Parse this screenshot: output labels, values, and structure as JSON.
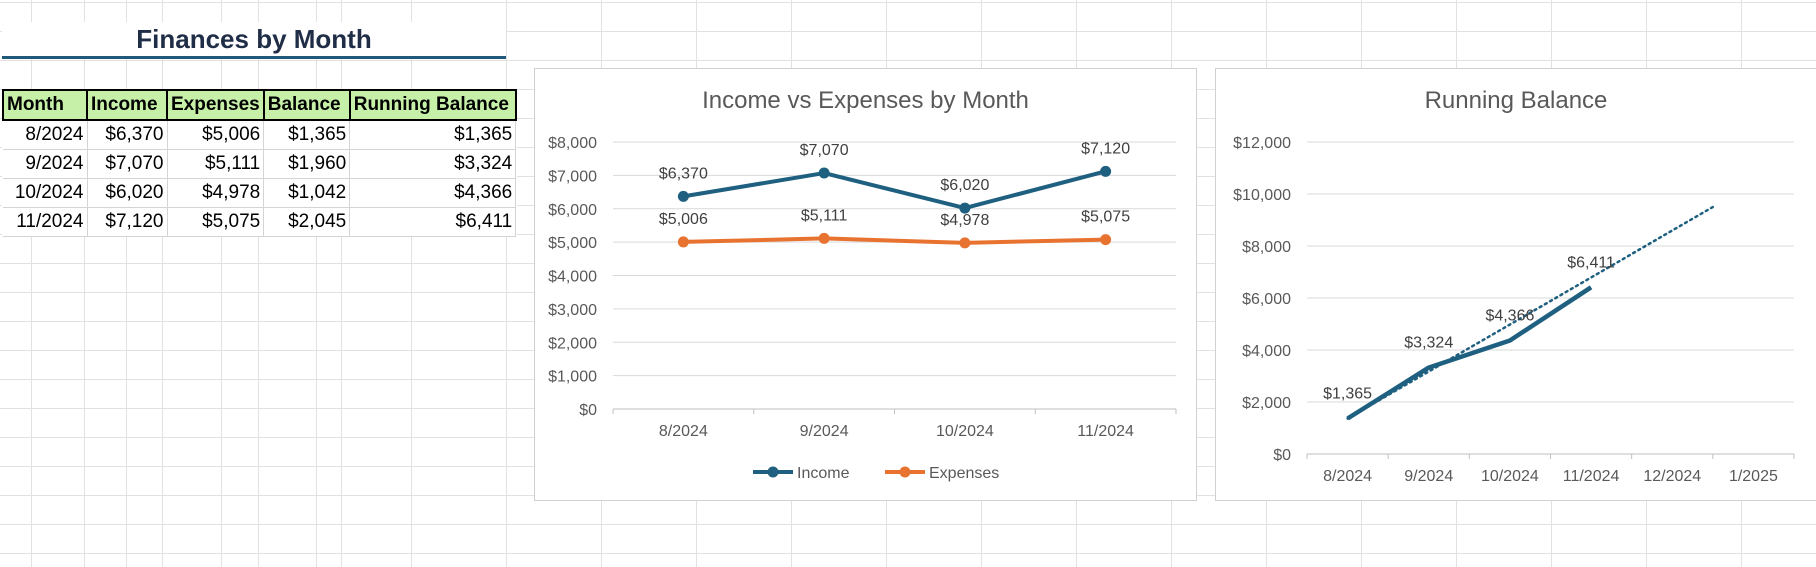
{
  "sheet": {
    "title": "Finances by Month",
    "table": {
      "headers": [
        "Month",
        "Income",
        "Expenses",
        "Balance",
        "Running Balance"
      ],
      "rows": [
        [
          "8/2024",
          "$6,370",
          "$5,006",
          "$1,365",
          "$1,365"
        ],
        [
          "9/2024",
          "$7,070",
          "$5,111",
          "$1,960",
          "$3,324"
        ],
        [
          "10/2024",
          "$6,020",
          "$4,978",
          "$1,042",
          "$4,366"
        ],
        [
          "11/2024",
          "$7,120",
          "$5,075",
          "$2,045",
          "$6,411"
        ]
      ]
    }
  },
  "colors": {
    "income": "#1f6080",
    "expenses": "#e87330",
    "header_fill": "#c6efa8",
    "title_underline": "#1f5a7a"
  },
  "chart_data": [
    {
      "type": "line",
      "title": "Income vs Expenses by Month",
      "categories": [
        "8/2024",
        "9/2024",
        "10/2024",
        "11/2024"
      ],
      "series": [
        {
          "name": "Income",
          "values": [
            6370,
            7070,
            6020,
            7120
          ],
          "labels": [
            "$6,370",
            "$7,070",
            "$6,020",
            "$7,120"
          ]
        },
        {
          "name": "Expenses",
          "values": [
            5006,
            5111,
            4978,
            5075
          ],
          "labels": [
            "$5,006",
            "$5,111",
            "$4,978",
            "$5,075"
          ]
        }
      ],
      "ylim": [
        0,
        8000
      ],
      "yticks": [
        "$0",
        "$1,000",
        "$2,000",
        "$3,000",
        "$4,000",
        "$5,000",
        "$6,000",
        "$7,000",
        "$8,000"
      ],
      "grid": true,
      "legend": "bottom"
    },
    {
      "type": "line",
      "title": "Running Balance",
      "categories": [
        "8/2024",
        "9/2024",
        "10/2024",
        "11/2024",
        "12/2024",
        "1/2025"
      ],
      "series": [
        {
          "values": [
            1365,
            3324,
            4366,
            6411
          ],
          "labels": [
            "$1,365",
            "$3,324",
            "$4,366",
            "$6,411"
          ]
        }
      ],
      "trendline": {
        "style": "dotted",
        "from": [
          1,
          1365
        ],
        "to": [
          5.5,
          9500
        ]
      },
      "ylim": [
        0,
        12000
      ],
      "yticks": [
        "$0",
        "$2,000",
        "$4,000",
        "$6,000",
        "$8,000",
        "$10,000",
        "$12,000"
      ],
      "grid": true,
      "legend": "none"
    }
  ]
}
